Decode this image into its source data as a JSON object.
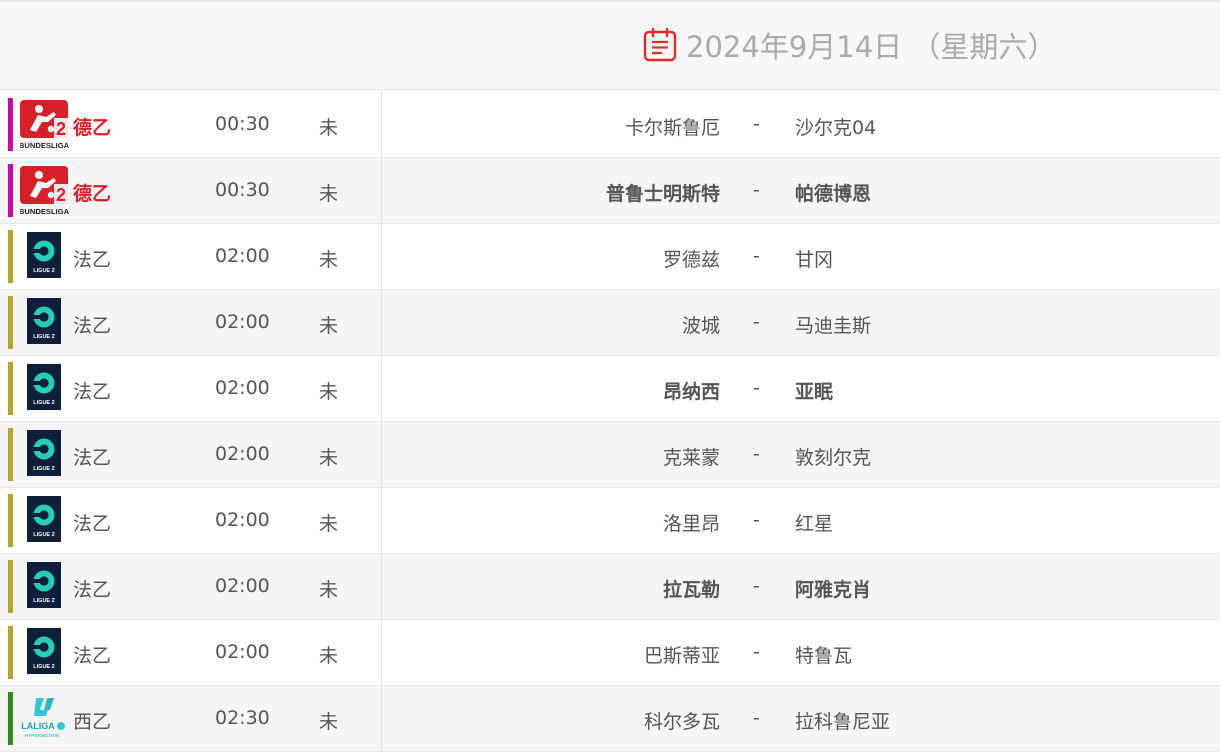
{
  "header": {
    "date": "2024年9月14日 （星期六）",
    "icon": "calendar-icon",
    "accent_color": "#e02a2a"
  },
  "colors": {
    "bundesliga2": "#cc00aa",
    "ligue2": "#b9a22a",
    "laliga2": "#2e8b1a",
    "bundesliga2_text": "#d8202a"
  },
  "matches": [
    {
      "league": "德乙",
      "league_key": "bundesliga2",
      "logo": "bundesliga-2-logo",
      "logo_text": "BUNDESLIGA",
      "time": "00:30",
      "status": "未",
      "home": "卡尔斯鲁厄",
      "away": "沙尔克04",
      "bold": false
    },
    {
      "league": "德乙",
      "league_key": "bundesliga2",
      "logo": "bundesliga-2-logo",
      "logo_text": "BUNDESLIGA",
      "time": "00:30",
      "status": "未",
      "home": "普鲁士明斯特",
      "away": "帕德博恩",
      "bold": true
    },
    {
      "league": "法乙",
      "league_key": "ligue2",
      "logo": "ligue-2-logo",
      "logo_text": "LIGUE 2",
      "time": "02:00",
      "status": "未",
      "home": "罗德兹",
      "away": "甘冈",
      "bold": false
    },
    {
      "league": "法乙",
      "league_key": "ligue2",
      "logo": "ligue-2-logo",
      "logo_text": "LIGUE 2",
      "time": "02:00",
      "status": "未",
      "home": "波城",
      "away": "马迪圭斯",
      "bold": false
    },
    {
      "league": "法乙",
      "league_key": "ligue2",
      "logo": "ligue-2-logo",
      "logo_text": "LIGUE 2",
      "time": "02:00",
      "status": "未",
      "home": "昂纳西",
      "away": "亚眠",
      "bold": true
    },
    {
      "league": "法乙",
      "league_key": "ligue2",
      "logo": "ligue-2-logo",
      "logo_text": "LIGUE 2",
      "time": "02:00",
      "status": "未",
      "home": "克莱蒙",
      "away": "敦刻尔克",
      "bold": false
    },
    {
      "league": "法乙",
      "league_key": "ligue2",
      "logo": "ligue-2-logo",
      "logo_text": "LIGUE 2",
      "time": "02:00",
      "status": "未",
      "home": "洛里昂",
      "away": "红星",
      "bold": false
    },
    {
      "league": "法乙",
      "league_key": "ligue2",
      "logo": "ligue-2-logo",
      "logo_text": "LIGUE 2",
      "time": "02:00",
      "status": "未",
      "home": "拉瓦勒",
      "away": "阿雅克肖",
      "bold": true
    },
    {
      "league": "法乙",
      "league_key": "ligue2",
      "logo": "ligue-2-logo",
      "logo_text": "LIGUE 2",
      "time": "02:00",
      "status": "未",
      "home": "巴斯蒂亚",
      "away": "特鲁瓦",
      "bold": false
    },
    {
      "league": "西乙",
      "league_key": "laliga2",
      "logo": "laliga-hypermotion-logo",
      "logo_text": "LALIGA",
      "logo_subtext": "HYPERMOTION",
      "time": "02:30",
      "status": "未",
      "home": "科尔多瓦",
      "away": "拉科鲁尼亚",
      "bold": false
    }
  ]
}
